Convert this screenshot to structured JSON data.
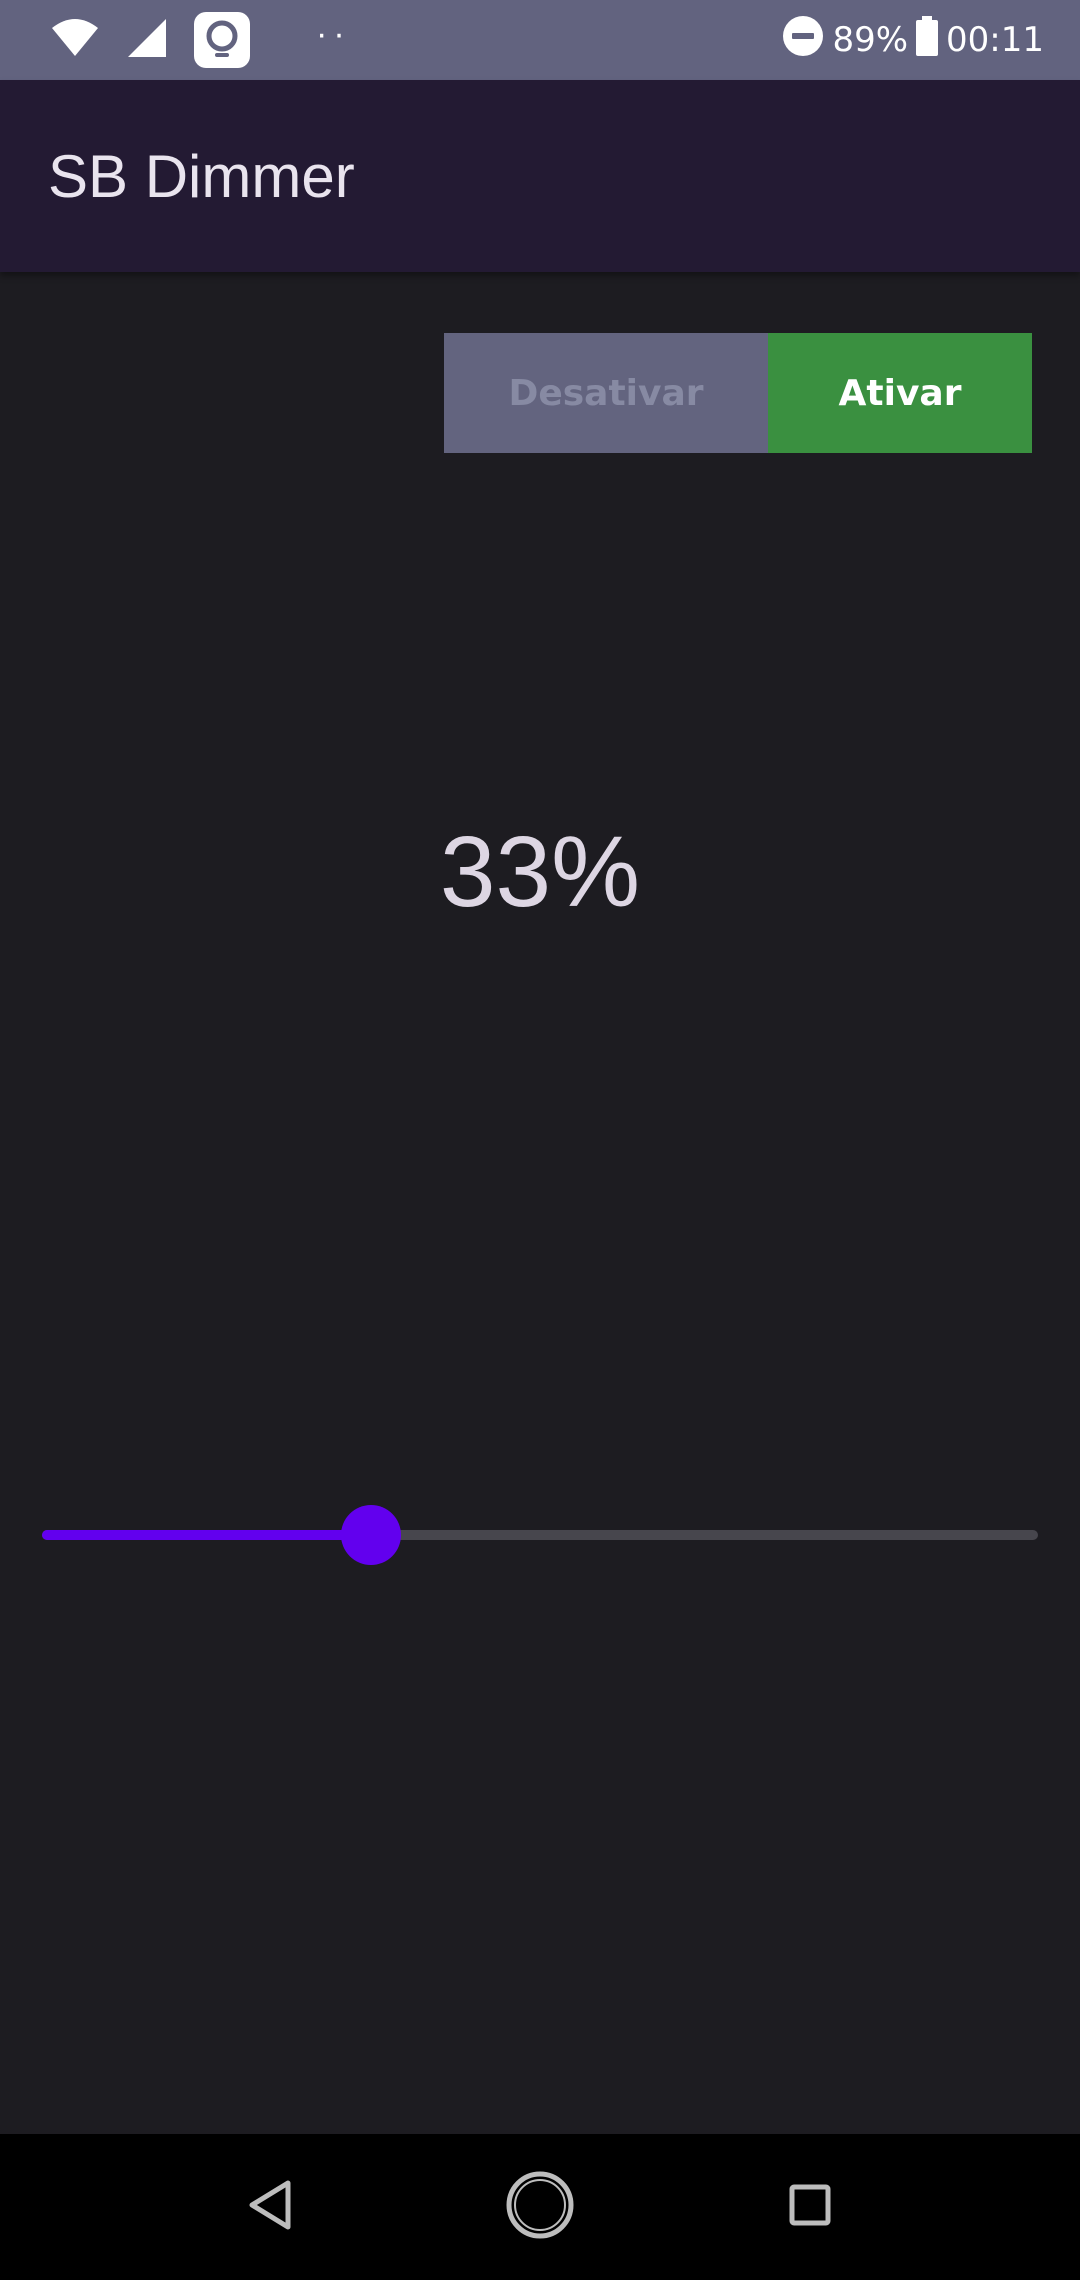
{
  "status_bar": {
    "battery": "89%",
    "time": "00:11",
    "dots": "··"
  },
  "app_bar": {
    "title": "SB Dimmer"
  },
  "toggle": {
    "off_label": "Desativar",
    "on_label": "Ativar",
    "selected": "Ativar"
  },
  "dimmer": {
    "percent_label": "33%",
    "value": 0.33
  },
  "colors": {
    "status_bar": "#62637f",
    "app_bar": "#231a33",
    "background": "#1d1c21",
    "accent": "#6200ee",
    "active_button": "#3a9040",
    "inactive_button": "#63647f"
  },
  "icons": {
    "status_left": [
      "wifi-icon",
      "cellular-signal-icon",
      "lens-app-icon"
    ],
    "status_right": [
      "do-not-disturb-icon",
      "battery-icon"
    ],
    "navigation": [
      "back-icon",
      "home-icon",
      "recents-icon"
    ]
  }
}
